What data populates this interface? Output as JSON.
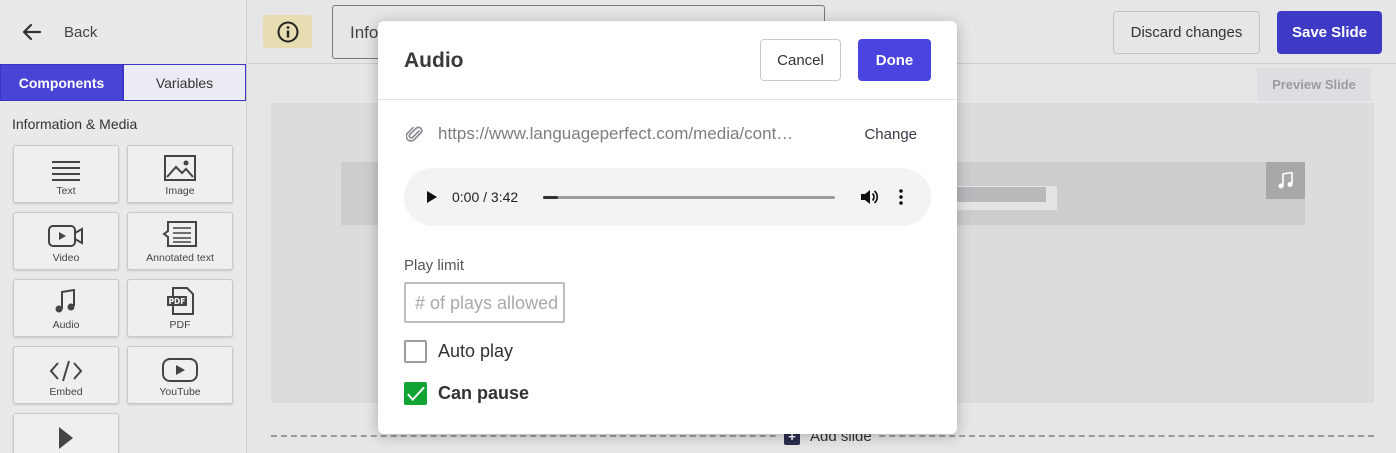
{
  "sidebar": {
    "back_label": "Back",
    "tabs": [
      {
        "label": "Components",
        "active": true
      },
      {
        "label": "Variables",
        "active": false
      }
    ],
    "section_title": "Information & Media",
    "components": [
      {
        "label": "Text",
        "icon": "text-lines-icon"
      },
      {
        "label": "Image",
        "icon": "image-icon"
      },
      {
        "label": "Video",
        "icon": "video-icon"
      },
      {
        "label": "Annotated text",
        "icon": "annotated-text-icon"
      },
      {
        "label": "Audio",
        "icon": "music-note-icon"
      },
      {
        "label": "PDF",
        "icon": "pdf-icon"
      },
      {
        "label": "Embed",
        "icon": "code-icon"
      },
      {
        "label": "YouTube",
        "icon": "youtube-icon"
      },
      {
        "label": "",
        "icon": "play-triangle-icon"
      }
    ]
  },
  "topbar": {
    "title_value": "Info",
    "discard_label": "Discard changes",
    "save_label": "Save Slide",
    "preview_label": "Preview Slide"
  },
  "canvas": {
    "add_slide_label": "Add slide"
  },
  "modal": {
    "title": "Audio",
    "cancel_label": "Cancel",
    "done_label": "Done",
    "url": "https://www.languageperfect.com/media/cont…",
    "change_label": "Change",
    "player": {
      "time": "0:00 / 3:42",
      "progress": 0.05
    },
    "play_limit_label": "Play limit",
    "play_limit_placeholder": "# of plays allowed",
    "auto_play_label": "Auto play",
    "auto_play_checked": false,
    "can_pause_label": "Can pause",
    "can_pause_checked": true
  },
  "colors": {
    "primary": "#4a44e0",
    "check_green": "#12a335",
    "info_badge": "#e8dcb2"
  }
}
